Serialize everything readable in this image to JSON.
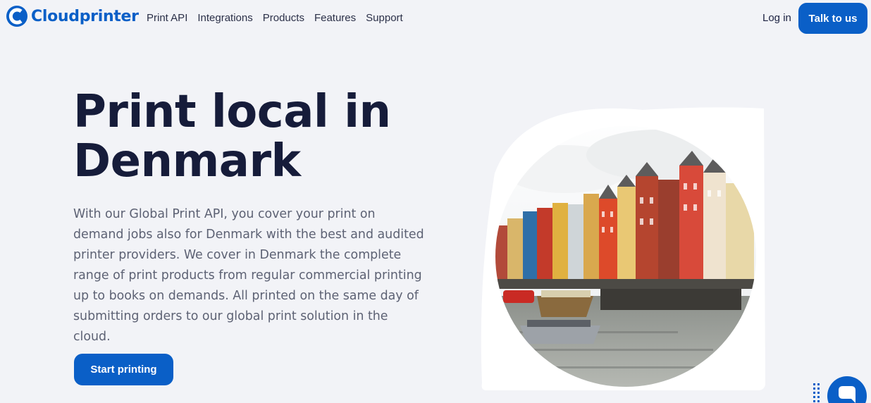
{
  "brand": {
    "name": "Cloudprinter",
    "color": "#0a5fc7"
  },
  "nav": {
    "items": [
      {
        "label": "Print API"
      },
      {
        "label": "Integrations"
      },
      {
        "label": "Products"
      },
      {
        "label": "Features"
      },
      {
        "label": "Support"
      }
    ],
    "login_label": "Log in",
    "talk_label": "Talk to us"
  },
  "hero": {
    "title": "Print local in Denmark",
    "description": "With our Global Print API, you cover your print on demand jobs also for Denmark with the best and audited printer providers. We cover in Denmark the complete range of print products from regular commercial printing up to books on demands. All printed on the same day of submitting orders to our global print solution in the cloud.",
    "cta_label": "Start printing"
  },
  "icons": {
    "logo": "cloudprinter-logo-icon",
    "chat": "chat-bubble-icon",
    "dots": "dots-grid-icon"
  }
}
